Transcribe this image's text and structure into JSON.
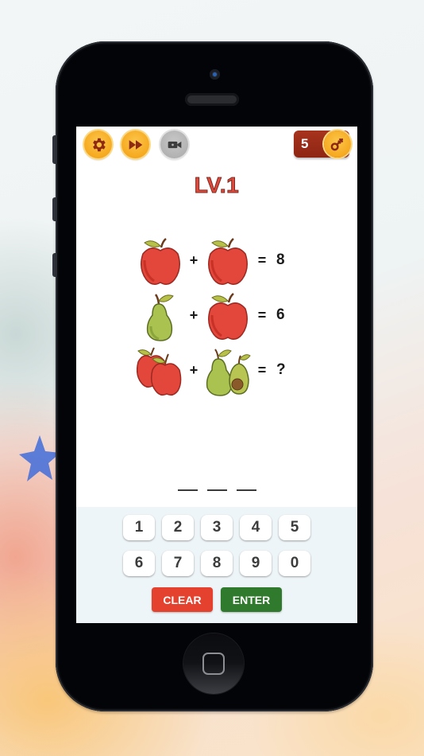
{
  "game": {
    "level_label": "LV.1",
    "keys_count": "5",
    "toolbar": {
      "settings_icon": "gear-icon",
      "skip_icon": "fast-forward-icon",
      "video_icon": "video-camera-icon",
      "key_icon": "key-icon"
    },
    "puzzle": {
      "rows": [
        {
          "left": "apple",
          "operator": "+",
          "right": "apple",
          "equals": "=",
          "result": "8"
        },
        {
          "left": "pear",
          "operator": "+",
          "right": "apple",
          "equals": "=",
          "result": "6"
        },
        {
          "left": "two-apples",
          "operator": "+",
          "right": "pear-and-avocado",
          "equals": "=",
          "result": "?"
        }
      ]
    },
    "answer": {
      "slots": 3,
      "value": ""
    },
    "keypad": {
      "row1": [
        "1",
        "2",
        "3",
        "4",
        "5"
      ],
      "row2": [
        "6",
        "7",
        "8",
        "9",
        "0"
      ],
      "clear_label": "CLEAR",
      "enter_label": "ENTER"
    },
    "colors": {
      "gold_button": "#f6a91f",
      "keys_badge": "#a7331d",
      "level_text": "#e04a3c",
      "clear_button": "#e4412e",
      "enter_button": "#2f7a2c",
      "keypad_bg": "#eef5f8"
    }
  }
}
